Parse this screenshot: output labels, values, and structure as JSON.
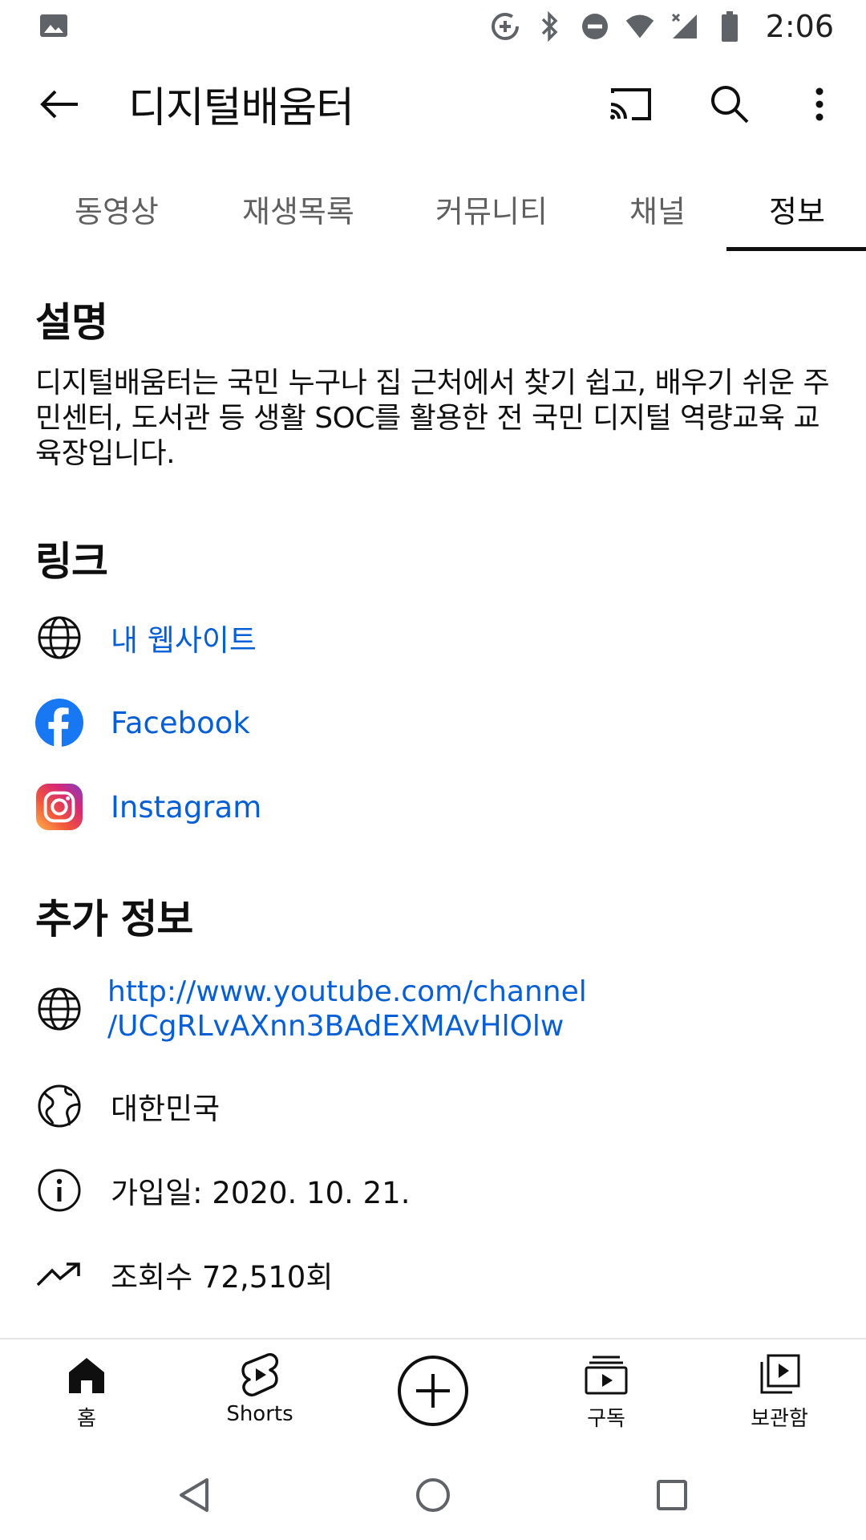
{
  "status_bar": {
    "time": "2:06",
    "icons": [
      "photo-icon",
      "data-saver-icon",
      "bluetooth-icon",
      "do-not-disturb-icon",
      "wifi-icon",
      "signal-icon",
      "battery-icon"
    ]
  },
  "app_bar": {
    "title": "디지털배움터",
    "icons": [
      "back-arrow-icon",
      "cast-icon",
      "search-icon",
      "more-vert-icon"
    ]
  },
  "tabs": [
    {
      "label": "동영상",
      "active": false
    },
    {
      "label": "재생목록",
      "active": false
    },
    {
      "label": "커뮤니티",
      "active": false
    },
    {
      "label": "채널",
      "active": false
    },
    {
      "label": "정보",
      "active": true
    }
  ],
  "about": {
    "description_heading": "설명",
    "description": "디지털배움터는 국민 누구나 집 근처에서 찾기 쉽고, 배우기 쉬운 주민센터, 도서관 등 생활 SOC를 활용한 전 국민 디지털 역량교육 교육장입니다.",
    "links_heading": "링크",
    "links": [
      {
        "label": "내 웹사이트",
        "icon": "globe-icon"
      },
      {
        "label": "Facebook",
        "icon": "facebook-icon"
      },
      {
        "label": "Instagram",
        "icon": "instagram-icon"
      }
    ],
    "more_info_heading": "추가 정보",
    "channel_url_line1": "http://www.youtube.com/channel",
    "channel_url_line2": "/UCgRLvAXnn3BAdEXMAvHlOlw",
    "country": "대한민국",
    "joined": "가입일: 2020. 10. 21.",
    "views": "조회수 72,510회"
  },
  "bottom_nav": {
    "home": "홈",
    "shorts": "Shorts",
    "subscriptions": "구독",
    "library": "보관함"
  },
  "colors": {
    "link": "#065fd4",
    "text": "#0f0f0f",
    "secondary": "#606060",
    "facebook": "#1877f2"
  }
}
